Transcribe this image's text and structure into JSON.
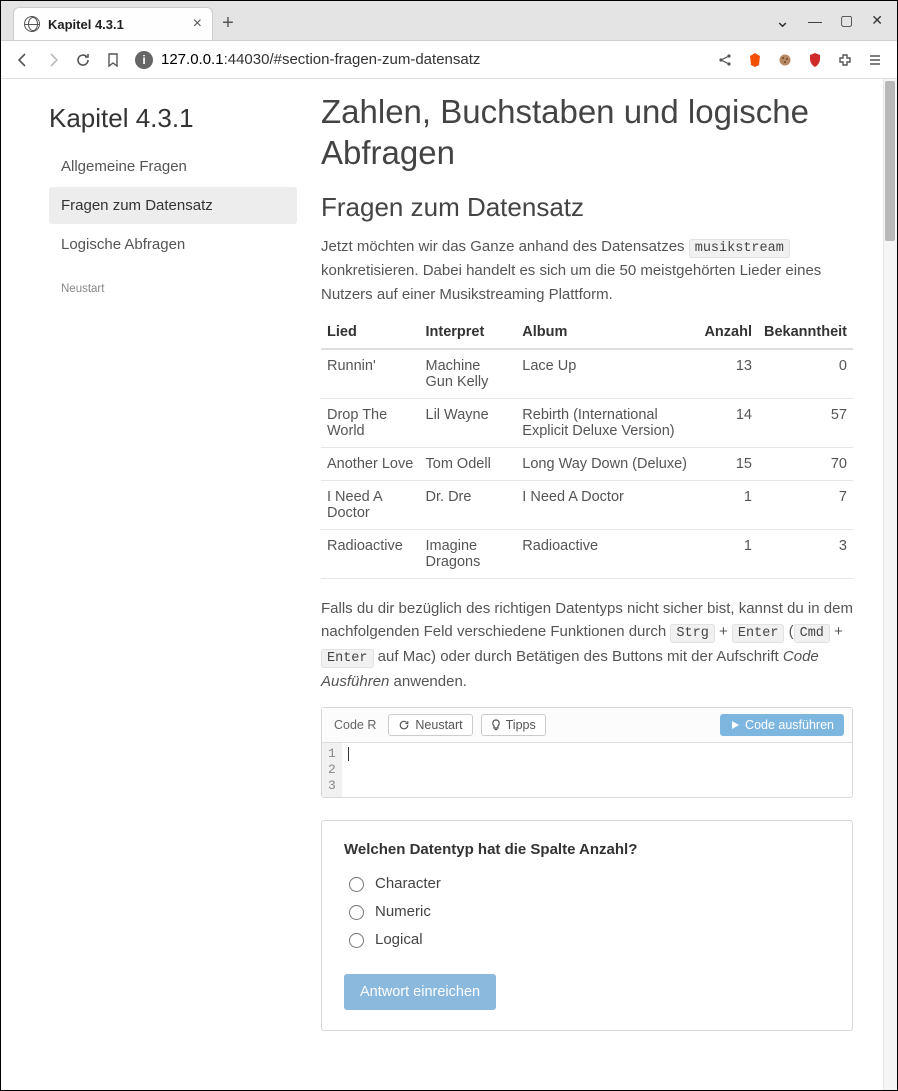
{
  "tab": {
    "title": "Kapitel 4.3.1"
  },
  "url": {
    "host": "127.0.0.1",
    "port": ":44030",
    "path": "/#section-fragen-zum-datensatz"
  },
  "sidebar": {
    "title": "Kapitel 4.3.1",
    "items": [
      {
        "label": "Allgemeine Fragen"
      },
      {
        "label": "Fragen zum Datensatz"
      },
      {
        "label": "Logische Abfragen"
      }
    ],
    "neustart": "Neustart"
  },
  "heading": "Zahlen, Buchstaben und logische Abfragen",
  "subheading": "Fragen zum Datensatz",
  "intro": {
    "p1a": "Jetzt möchten wir das Ganze anhand des Datensatzes ",
    "code": "musikstream",
    "p1b": " konkretisieren. Dabei handelt es sich um die 50 meistgehörten Lieder eines Nutzers auf einer Musikstreaming Plattform."
  },
  "table": {
    "headers": [
      "Lied",
      "Interpret",
      "Album",
      "Anzahl",
      "Bekanntheit"
    ],
    "rows": [
      [
        "Runnin'",
        "Machine Gun Kelly",
        "Lace Up",
        "13",
        "0"
      ],
      [
        "Drop The World",
        "Lil Wayne",
        "Rebirth (International Explicit Deluxe Version)",
        "14",
        "57"
      ],
      [
        "Another Love",
        "Tom Odell",
        "Long Way Down (Deluxe)",
        "15",
        "70"
      ],
      [
        "I Need A Doctor",
        "Dr. Dre",
        "I Need A Doctor",
        "1",
        "7"
      ],
      [
        "Radioactive",
        "Imagine Dragons",
        "Radioactive",
        "1",
        "3"
      ]
    ]
  },
  "para2": {
    "a": "Falls du dir bezüglich des richtigen Datentyps nicht sicher bist, kannst du in dem nachfolgenden Feld verschiedene Funktionen durch ",
    "k1": "Strg",
    "plus1": " + ",
    "k2": "Enter",
    "b": " (",
    "k3": "Cmd",
    "plus2": " + ",
    "k4": "Enter",
    "c": " auf Mac) oder durch Betätigen des Buttons mit der Aufschrift ",
    "em": "Code Ausführen",
    "d": " anwenden."
  },
  "codebox": {
    "label": "Code R",
    "neustart": "Neustart",
    "tipps": "Tipps",
    "run": "Code ausführen",
    "lines": [
      "1",
      "2",
      "3"
    ]
  },
  "quiz": {
    "question": "Welchen Datentyp hat die Spalte Anzahl?",
    "options": [
      "Character",
      "Numeric",
      "Logical"
    ],
    "submit": "Antwort einreichen"
  }
}
